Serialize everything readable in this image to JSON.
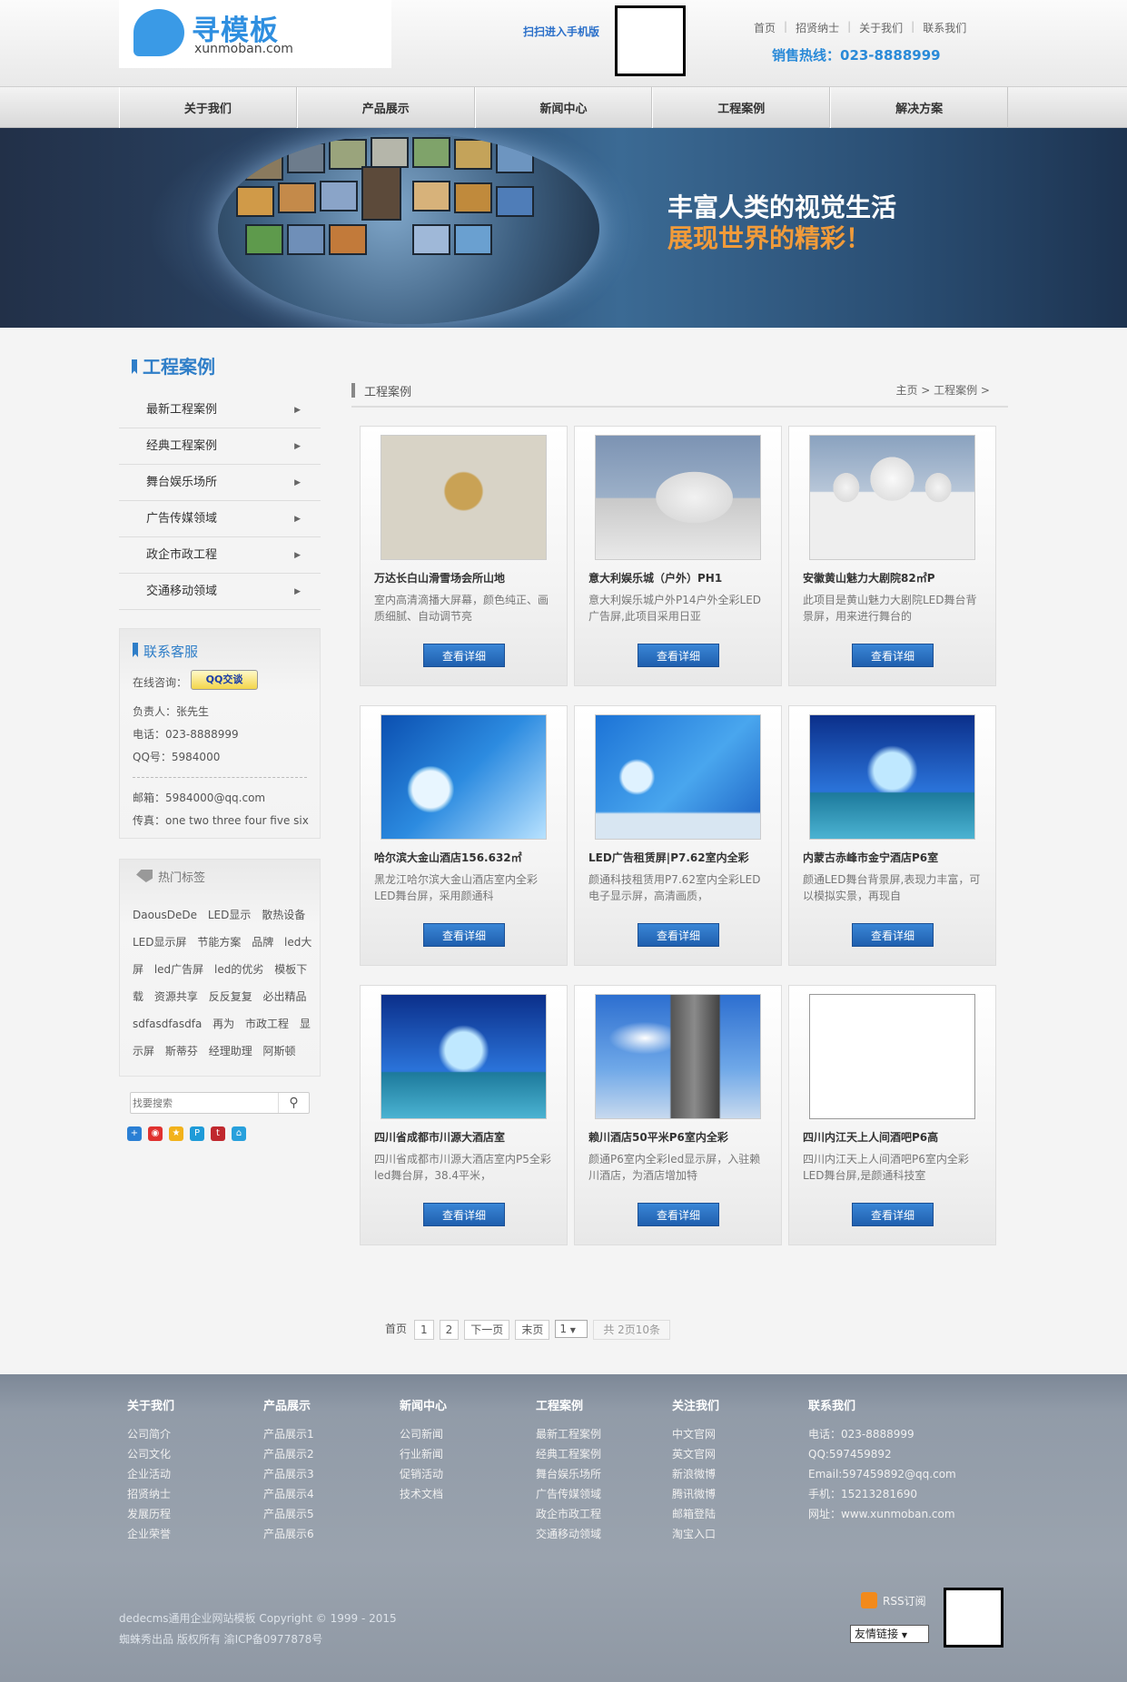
{
  "header": {
    "logo_cn": "寻模板",
    "logo_en": "xunmoban.com",
    "scan_text": "扫扫进入手机版",
    "top_links": [
      "首页",
      "招贤纳士",
      "关于我们",
      "联系我们"
    ],
    "hotline": "销售热线：023-8888999"
  },
  "nav": [
    "关于我们",
    "产品展示",
    "新闻中心",
    "工程案例",
    "解决方案"
  ],
  "banner": {
    "line1": "丰富人类的视觉生活",
    "line2": "展现世界的精彩！"
  },
  "sidebar": {
    "title": "工程案例",
    "menu": [
      "最新工程案例",
      "经典工程案例",
      "舞台娱乐场所",
      "广告传媒领域",
      "政企市政工程",
      "交通移动领域"
    ],
    "contact": {
      "title": "联系客服",
      "online_label": "在线咨询：",
      "qq_button": "QQ交谈",
      "person": "负责人：张先生",
      "phone": "电话：023-8888999",
      "qq": "QQ号：5984000",
      "email": "邮箱：5984000@qq.com",
      "fax": "传真：one two three four five six"
    },
    "tags_title": "热门标签",
    "tags": [
      "DaousDeDe",
      "LED显示",
      "散热设备",
      "LED显示屏",
      "节能方案",
      "品牌",
      "led大屏",
      "led广告屏",
      "led的优劣",
      "模板下载",
      "资源共享",
      "反反复复",
      "必出精品",
      "sdfasdfasdfa",
      "再为",
      "市政工程",
      "显示屏",
      "斯蒂芬",
      "经理助理",
      "阿斯顿"
    ],
    "search_placeholder": "找要搜索",
    "search_icon": "magnifier-icon"
  },
  "main": {
    "section_title": "工程案例",
    "breadcrumb": "主页 > 工程案例 >",
    "more_label": "查看详细",
    "cases": [
      {
        "title": "万达长白山滑雪场会所山地",
        "desc": "室内高清滴播大屏幕，颜色纯正、画质细腻、自动调节亮"
      },
      {
        "title": "意大利娱乐城（户外）PH1",
        "desc": "意大利娱乐城户外P14户外全彩LED广告屏,此项目采用日亚"
      },
      {
        "title": "安徽黄山魅力大剧院82㎡P",
        "desc": "此项目是黄山魅力大剧院LED舞台背景屏，用来进行舞台的"
      },
      {
        "title": "哈尔滨大金山酒店156.632㎡",
        "desc": "黑龙江哈尔滨大金山酒店室内全彩LED舞台屏，采用颜通科"
      },
      {
        "title": "LED广告租赁屏|P7.62室内全彩",
        "desc": "颜通科技租赁用P7.62室内全彩LED电子显示屏，高清画质，"
      },
      {
        "title": "内蒙古赤峰市金宁酒店P6室",
        "desc": "颜通LED舞台背景屏,表现力丰富，可以模拟实景，再现自"
      },
      {
        "title": "四川省成都市川源大酒店室",
        "desc": "四川省成都市川源大酒店室内P5全彩led舞台屏，38.4平米，"
      },
      {
        "title": "赖川酒店50平米P6室内全彩",
        "desc": "颜通P6室内全彩led显示屏，入驻赖川酒店，为酒店增加特"
      },
      {
        "title": "四川内江天上人间酒吧P6高",
        "desc": "四川内江天上人间酒吧P6室内全彩LED舞台屏,是颜通科技室"
      }
    ]
  },
  "pager": {
    "first": "首页",
    "pages": [
      "1",
      "2"
    ],
    "next": "下一页",
    "last": "末页",
    "select": "1",
    "info": "共 2页10条"
  },
  "footer": {
    "columns": [
      {
        "title": "关于我们",
        "items": [
          "公司简介",
          "公司文化",
          "企业活动",
          "招贤纳士",
          "发展历程",
          "企业荣誉"
        ]
      },
      {
        "title": "产品展示",
        "items": [
          "产品展示1",
          "产品展示2",
          "产品展示3",
          "产品展示4",
          "产品展示5",
          "产品展示6"
        ]
      },
      {
        "title": "新闻中心",
        "items": [
          "公司新闻",
          "行业新闻",
          "促销活动",
          "技术文档"
        ]
      },
      {
        "title": "工程案例",
        "items": [
          "最新工程案例",
          "经典工程案例",
          "舞台娱乐场所",
          "广告传媒领域",
          "政企市政工程",
          "交通移动领域"
        ]
      },
      {
        "title": "关注我们",
        "items": [
          "中文官网",
          "英文官网",
          "新浪微博",
          "腾讯微博",
          "邮箱登陆",
          "淘宝入口"
        ]
      },
      {
        "title": "联系我们",
        "items": [
          "电话：023-8888999",
          "QQ:597459892",
          "Email:597459892@qq.com",
          "手机：15213281690",
          "网址：www.xunmoban.com"
        ]
      }
    ],
    "copyright1": "dedecms通用企业网站模板 Copyright © 1999 - 2015",
    "copyright2": "蜘蛛秀出品 版权所有 渝ICP备0977878号",
    "rss": "RSS订阅",
    "friend_links": "友情链接"
  },
  "colors": {
    "accent": "#2f7ec8",
    "button": "#2a72c2",
    "banner_orange": "#f19b3a",
    "footer_bg": "#939ca8"
  }
}
